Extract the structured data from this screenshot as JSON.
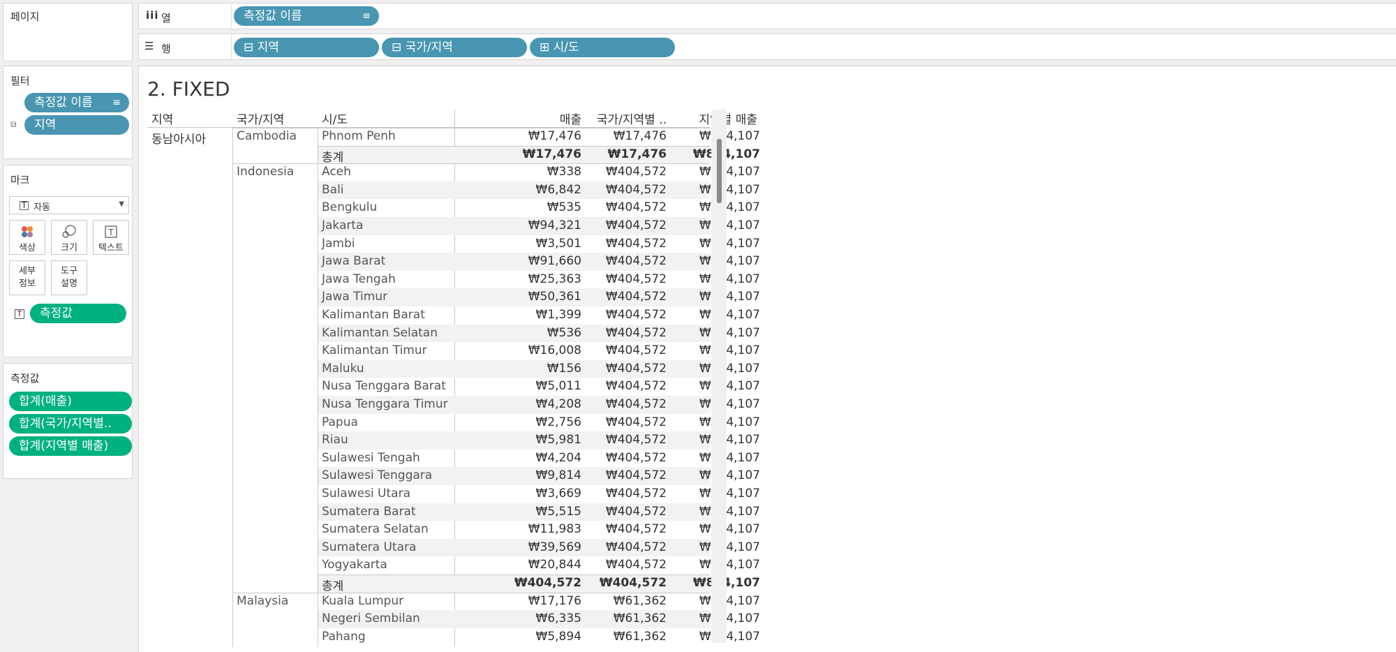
{
  "pages_card": {
    "title": "페이지"
  },
  "columns_shelf": {
    "label": "열",
    "icon": "columns-icon",
    "pill": "측정값 이름",
    "pill_sort_icon": "sort-icon"
  },
  "rows_shelf": {
    "label": "행",
    "icon": "rows-icon",
    "pills": [
      {
        "label": "지역",
        "expand": "⊟"
      },
      {
        "label": "국가/지역",
        "expand": "⊟"
      },
      {
        "label": "시/도",
        "expand": "⊞"
      }
    ]
  },
  "filters_card": {
    "title": "필터",
    "pills": [
      "측정값 이름",
      "지역"
    ]
  },
  "marks_card": {
    "title": "마크",
    "type_select": "자동",
    "buttons": {
      "color": "색상",
      "size": "크기",
      "text": "텍스트",
      "detail": "세부\n정보",
      "tooltip": "도구\n설명"
    },
    "text_pill": "측정값"
  },
  "measures_card": {
    "title": "측정값",
    "pills": [
      "합계(매출)",
      "합계(국가/지역별..",
      "합계(지역별 매출)"
    ]
  },
  "view": {
    "title": "2. FIXED",
    "headers": {
      "region": "지역",
      "country": "국가/지역",
      "state": "시/도",
      "sales": "매출",
      "country_sales": "국가/지역별 ..",
      "region_sales": "지역별 매출"
    },
    "region_value": "동남아시아",
    "rows": [
      {
        "country": "Cambodia",
        "state": "Phnom Penh",
        "sales": "₩17,476",
        "country_sales": "₩17,476",
        "region_sales": "₩884,107"
      },
      {
        "state": "총계",
        "sales": "₩17,476",
        "country_sales": "₩17,476",
        "region_sales": "₩884,107",
        "total": true
      },
      {
        "country": "Indonesia",
        "state": "Aceh",
        "sales": "₩338",
        "country_sales": "₩404,572",
        "region_sales": "₩884,107"
      },
      {
        "state": "Bali",
        "sales": "₩6,842",
        "country_sales": "₩404,572",
        "region_sales": "₩884,107"
      },
      {
        "state": "Bengkulu",
        "sales": "₩535",
        "country_sales": "₩404,572",
        "region_sales": "₩884,107"
      },
      {
        "state": "Jakarta",
        "sales": "₩94,321",
        "country_sales": "₩404,572",
        "region_sales": "₩884,107"
      },
      {
        "state": "Jambi",
        "sales": "₩3,501",
        "country_sales": "₩404,572",
        "region_sales": "₩884,107"
      },
      {
        "state": "Jawa Barat",
        "sales": "₩91,660",
        "country_sales": "₩404,572",
        "region_sales": "₩884,107"
      },
      {
        "state": "Jawa Tengah",
        "sales": "₩25,363",
        "country_sales": "₩404,572",
        "region_sales": "₩884,107"
      },
      {
        "state": "Jawa Timur",
        "sales": "₩50,361",
        "country_sales": "₩404,572",
        "region_sales": "₩884,107"
      },
      {
        "state": "Kalimantan Barat",
        "sales": "₩1,399",
        "country_sales": "₩404,572",
        "region_sales": "₩884,107"
      },
      {
        "state": "Kalimantan Selatan",
        "sales": "₩536",
        "country_sales": "₩404,572",
        "region_sales": "₩884,107"
      },
      {
        "state": "Kalimantan Timur",
        "sales": "₩16,008",
        "country_sales": "₩404,572",
        "region_sales": "₩884,107"
      },
      {
        "state": "Maluku",
        "sales": "₩156",
        "country_sales": "₩404,572",
        "region_sales": "₩884,107"
      },
      {
        "state": "Nusa Tenggara Barat",
        "sales": "₩5,011",
        "country_sales": "₩404,572",
        "region_sales": "₩884,107"
      },
      {
        "state": "Nusa Tenggara Timur",
        "sales": "₩4,208",
        "country_sales": "₩404,572",
        "region_sales": "₩884,107"
      },
      {
        "state": "Papua",
        "sales": "₩2,756",
        "country_sales": "₩404,572",
        "region_sales": "₩884,107"
      },
      {
        "state": "Riau",
        "sales": "₩5,981",
        "country_sales": "₩404,572",
        "region_sales": "₩884,107"
      },
      {
        "state": "Sulawesi Tengah",
        "sales": "₩4,204",
        "country_sales": "₩404,572",
        "region_sales": "₩884,107"
      },
      {
        "state": "Sulawesi Tenggara",
        "sales": "₩9,814",
        "country_sales": "₩404,572",
        "region_sales": "₩884,107"
      },
      {
        "state": "Sulawesi Utara",
        "sales": "₩3,669",
        "country_sales": "₩404,572",
        "region_sales": "₩884,107"
      },
      {
        "state": "Sumatera Barat",
        "sales": "₩5,515",
        "country_sales": "₩404,572",
        "region_sales": "₩884,107"
      },
      {
        "state": "Sumatera Selatan",
        "sales": "₩11,983",
        "country_sales": "₩404,572",
        "region_sales": "₩884,107"
      },
      {
        "state": "Sumatera Utara",
        "sales": "₩39,569",
        "country_sales": "₩404,572",
        "region_sales": "₩884,107"
      },
      {
        "state": "Yogyakarta",
        "sales": "₩20,844",
        "country_sales": "₩404,572",
        "region_sales": "₩884,107"
      },
      {
        "state": "총계",
        "sales": "₩404,572",
        "country_sales": "₩404,572",
        "region_sales": "₩884,107",
        "total": true
      },
      {
        "country": "Malaysia",
        "state": "Kuala Lumpur",
        "sales": "₩17,176",
        "country_sales": "₩61,362",
        "region_sales": "₩884,107"
      },
      {
        "state": "Negeri Sembilan",
        "sales": "₩6,335",
        "country_sales": "₩61,362",
        "region_sales": "₩884,107"
      },
      {
        "state": "Pahang",
        "sales": "₩5,894",
        "country_sales": "₩61,362",
        "region_sales": "₩884,107"
      }
    ]
  },
  "colors": {
    "blue_pill": "#4996b2",
    "green_pill": "#00b180",
    "band": "#f2f2f2"
  }
}
